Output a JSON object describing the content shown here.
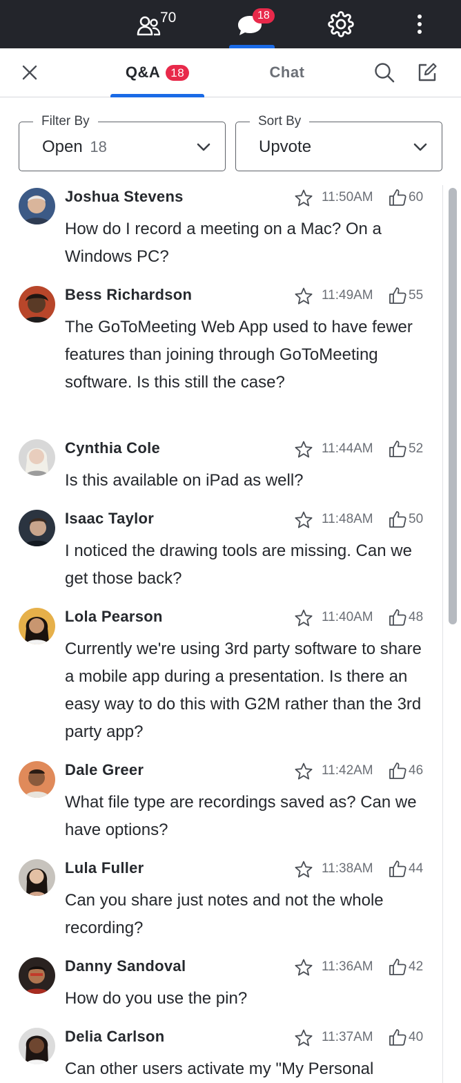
{
  "topbar": {
    "attendees_count": "70",
    "chat_badge": "18"
  },
  "tabs": {
    "qa_label": "Q&A",
    "qa_badge": "18",
    "chat_label": "Chat"
  },
  "filter": {
    "legend": "Filter By",
    "value": "Open",
    "count": "18"
  },
  "sort": {
    "legend": "Sort By",
    "value": "Upvote"
  },
  "questions": [
    {
      "name": "Joshua Stevens",
      "time": "11:50AM",
      "votes": "60",
      "text": "How do I record a meeting on a Mac? On a Windows PC?"
    },
    {
      "name": "Bess Richardson",
      "time": "11:49AM",
      "votes": "55",
      "text": "The GoToMeeting Web App used to have fewer features than joining through GoToMeeting software. Is this still the case?"
    },
    {
      "name": "Cynthia Cole",
      "time": "11:44AM",
      "votes": "52",
      "text": "Is this available on iPad as well?"
    },
    {
      "name": "Isaac Taylor",
      "time": "11:48AM",
      "votes": "50",
      "text": "I noticed the drawing tools are missing. Can we get those back?"
    },
    {
      "name": "Lola Pearson",
      "time": "11:40AM",
      "votes": "48",
      "text": "Currently we're using 3rd party software to share a mobile app during a presentation. Is there an easy way to do this with G2M rather than the 3rd party app?"
    },
    {
      "name": "Dale Greer",
      "time": "11:42AM",
      "votes": "46",
      "text": "What file type are recordings saved as? Can we have options?"
    },
    {
      "name": "Lula Fuller",
      "time": "11:38AM",
      "votes": "44",
      "text": "Can you share just notes and not the whole recording?"
    },
    {
      "name": "Danny Sandoval",
      "time": "11:36AM",
      "votes": "42",
      "text": "How do you use the pin?"
    },
    {
      "name": "Delia Carlson",
      "time": "11:37AM",
      "votes": "40",
      "text": "Can other users activate my \"My Personal"
    }
  ],
  "icons": {
    "attendees": "people-icon",
    "chat": "chat-bubble-icon",
    "settings": "gear-icon",
    "more": "more-vertical-icon",
    "close": "close-icon",
    "search": "search-icon",
    "compose": "compose-icon",
    "star": "star-icon",
    "upvote": "thumbs-up-icon",
    "chevron": "chevron-down-icon"
  },
  "colors": {
    "topbar": "#23252b",
    "accent": "#1a6ae6",
    "badge": "#e8294a",
    "text": "#25282d",
    "muted": "#6b6f76"
  }
}
